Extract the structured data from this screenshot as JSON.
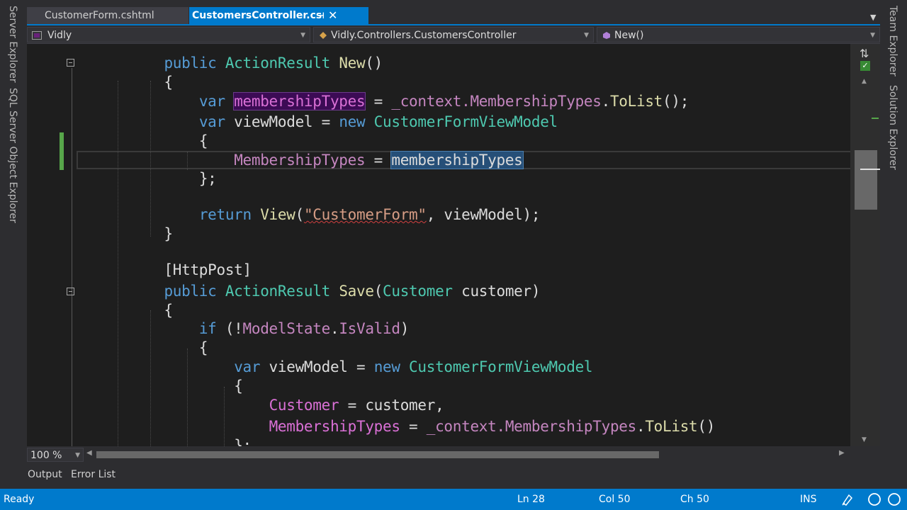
{
  "tabs": [
    {
      "label": "CustomerForm.cshtml",
      "active": false
    },
    {
      "label": "CustomersController.cs",
      "active": true
    }
  ],
  "tab_pin": "⊣",
  "tab_close": "✕",
  "nav": {
    "project": "Vidly",
    "class": "Vidly.Controllers.CustomersController",
    "member": "New()"
  },
  "left_panels": [
    "Server Explorer",
    "SQL Server Object Explorer"
  ],
  "right_panels": [
    "Team Explorer",
    "Solution Explorer"
  ],
  "code": {
    "l1": {
      "kw": "public",
      "type": "ActionResult",
      "method": "New",
      "rest": "()"
    },
    "l2": "{",
    "l3": {
      "kw": "var",
      "hl": "membershipTypes",
      "eq": " = ",
      "ctx": "_context.",
      "prop": "MembershipTypes",
      "dot": ".",
      "method": "ToList",
      "end": "();"
    },
    "l4": {
      "kw": "var",
      "name": " viewModel = ",
      "kw2": "new",
      "type": " CustomerFormViewModel"
    },
    "l5": "{",
    "l6": {
      "prop": "MembershipTypes",
      "eq": " = ",
      "hl": "membershipTypes"
    },
    "l7": "};",
    "l8": {
      "kw": "return",
      "method": "View",
      "open": "(",
      "q1": "\"",
      "str": "CustomerForm",
      "q2": "\"",
      "rest": ", viewModel);"
    },
    "l9": "}",
    "l10": "[HttpPost]",
    "l11": {
      "kw": "public",
      "type": "ActionResult",
      "method": "Save",
      "open": "(",
      "ptype": "Customer",
      "rest": " customer)"
    },
    "l12": "{",
    "l13": {
      "kw": "if",
      "open": " (!",
      "prop": "ModelState",
      "dot": ".",
      "prop2": "IsValid",
      "close": ")"
    },
    "l14": "{",
    "l15": {
      "kw": "var",
      "name": " viewModel = ",
      "kw2": "new",
      "type": " CustomerFormViewModel"
    },
    "l16": "{",
    "l17": {
      "prop": "Customer",
      "rest": " = customer,"
    },
    "l18": {
      "prop": "MembershipTypes",
      "eq": " = ",
      "ctx": "_context.",
      "prop2": "MembershipTypes",
      "dot": ".",
      "method": "ToList",
      "end": "()"
    },
    "l19": "};"
  },
  "zoom": "100 %",
  "output_tabs": [
    "Output",
    "Error List"
  ],
  "status": {
    "ready": "Ready",
    "ln": "Ln 28",
    "col": "Col 50",
    "ch": "Ch 50",
    "mode": "INS"
  },
  "colors": {
    "accent": "#007acc",
    "editor_bg": "#1e1e1e",
    "keyword": "#569cd6",
    "type": "#4ec9b0",
    "method": "#dcdcaa"
  }
}
